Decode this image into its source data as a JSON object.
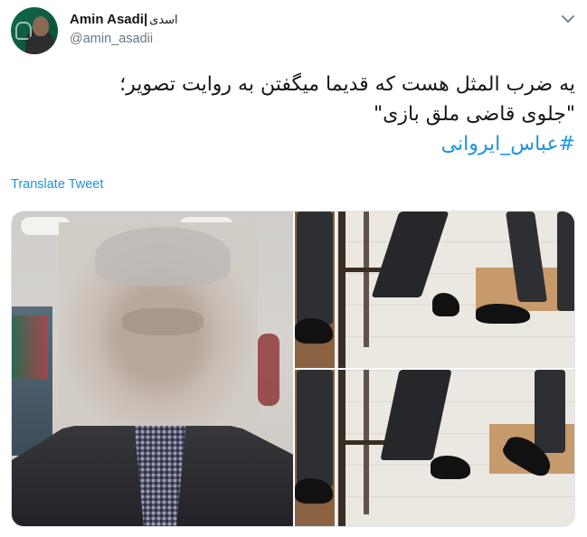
{
  "author": {
    "display_name": "Amin Asadi|",
    "display_name_suffix": "اسدی",
    "handle": "@amin_asadii"
  },
  "tweet": {
    "line1": "یه ضرب المثل هست که قدیما میگفتن به روایت تصویر؛",
    "line2": "\"جلوی قاضی ملق بازی\"",
    "hashtag": "#عباس_ایروانی"
  },
  "actions": {
    "translate": "Translate Tweet"
  },
  "icons": {
    "menu": "chevron-down-icon"
  },
  "colors": {
    "link": "#1b95e0",
    "secondary_text": "#657786",
    "text": "#14171a"
  }
}
